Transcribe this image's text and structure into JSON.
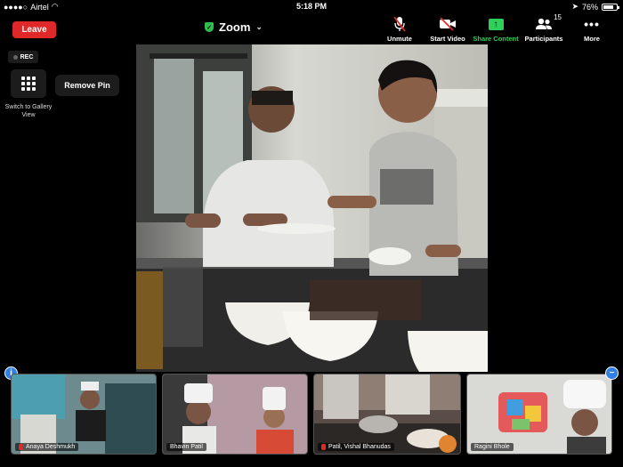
{
  "status_bar": {
    "carrier": "Airtel",
    "time": "5:18 PM",
    "battery": "76%",
    "battery_level": 0.76
  },
  "top_bar": {
    "leave_label": "Leave",
    "title": "Zoom",
    "tools": {
      "unmute": "Unmute",
      "start_video": "Start Video",
      "share_content": "Share Content",
      "participants": "Participants",
      "participant_count": "15",
      "more": "More"
    },
    "colors": {
      "leave": "#e02828",
      "share": "#2fcf5a",
      "secure": "#2fbf4f"
    }
  },
  "overlay": {
    "rec_label": "REC",
    "gallery_label": "Switch to Gallery View",
    "remove_pin_label": "Remove Pin"
  },
  "thumbnails": [
    {
      "name": "Anaya Deshmukh",
      "muted": true
    },
    {
      "name": "Bhavin Patil",
      "muted": false
    },
    {
      "name": "Patil, Vishal Bhanudas",
      "muted": true
    },
    {
      "name": "Ragini Bhole",
      "muted": false
    }
  ]
}
